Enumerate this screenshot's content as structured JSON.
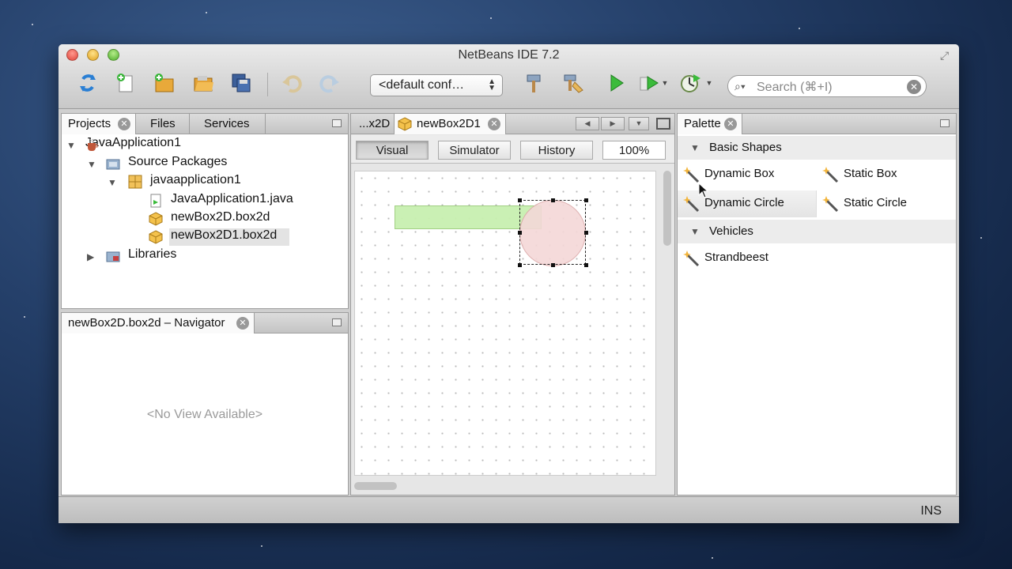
{
  "window": {
    "title": "NetBeans IDE 7.2"
  },
  "toolbar": {
    "config_value": "<default conf…",
    "search_placeholder": "Search (⌘+I)"
  },
  "projects_panel": {
    "tabs": [
      {
        "label": "Projects"
      },
      {
        "label": "Files"
      },
      {
        "label": "Services"
      }
    ],
    "tree": [
      {
        "label": "JavaApplication1"
      },
      {
        "label": "Source Packages"
      },
      {
        "label": "javaapplication1"
      },
      {
        "label": "JavaApplication1.java"
      },
      {
        "label": "newBox2D.box2d"
      },
      {
        "label": "newBox2D1.box2d"
      },
      {
        "label": "Libraries"
      }
    ]
  },
  "navigator_panel": {
    "title": "newBox2D.box2d – Navigator",
    "empty_text": "<No View Available>"
  },
  "editor": {
    "tabs": [
      {
        "label": "...x2D"
      },
      {
        "label": "newBox2D1"
      }
    ],
    "view_buttons": {
      "visual": "Visual",
      "simulator": "Simulator",
      "history": "History"
    },
    "zoom": "100%",
    "colors": {
      "box_fill": "#c8f0b0",
      "circle_fill": "#f4d8d8"
    }
  },
  "palette": {
    "title": "Palette",
    "sections": [
      {
        "label": "Basic Shapes"
      },
      {
        "label": "Vehicles"
      }
    ],
    "items": [
      {
        "label": "Dynamic Box"
      },
      {
        "label": "Static Box"
      },
      {
        "label": "Dynamic Circle"
      },
      {
        "label": "Static Circle"
      },
      {
        "label": "Strandbeest"
      }
    ]
  },
  "statusbar": {
    "mode": "INS"
  }
}
